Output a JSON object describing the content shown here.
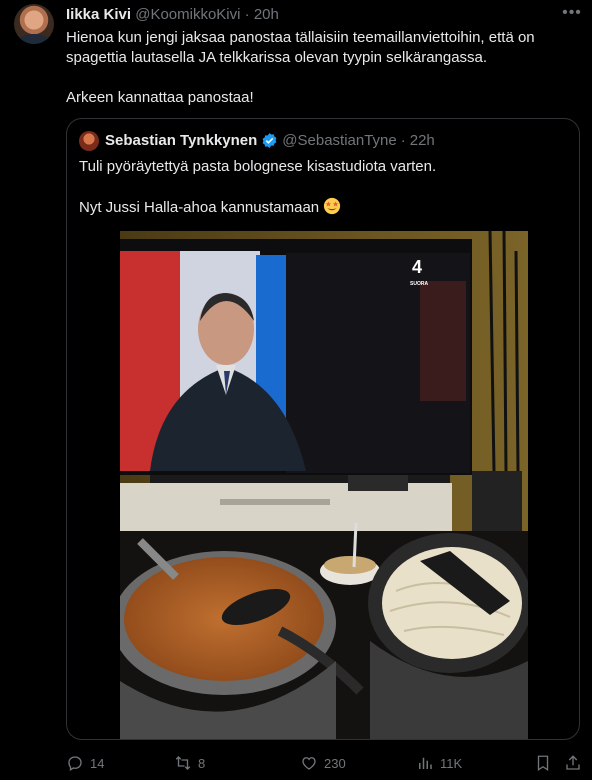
{
  "tweet": {
    "author_name": "Iikka Kivi",
    "author_handle": "@KoomikkoKivi",
    "separator": "·",
    "time": "20h",
    "text_lines": [
      "Hienoa kun jengi jaksaa panostaa tällaisiin teemaillanviettoihin, että on spagettia lautasella JA telkkarissa olevan tyypin selkärangassa.",
      "",
      "Arkeen kannattaa panostaa!"
    ]
  },
  "quote": {
    "author_name": "Sebastian Tynkkynen",
    "author_handle": "@SebastianTyne",
    "separator": "·",
    "time": "22h",
    "text_lines": [
      "Tuli pyöräytettyä pasta bolognese kisastudiota varten.",
      "",
      "Nyt Jussi Halla-ahoa kannustamaan"
    ],
    "tv_channel_number": "4",
    "tv_channel_label": "SUORA"
  },
  "actions": {
    "replies": "14",
    "retweets": "8",
    "likes": "230",
    "views": "11K"
  },
  "colors": {
    "background": "#000000",
    "text": "#e7e9ea",
    "muted": "#71767b",
    "border": "#2f3336",
    "verified": "#1d9bf0"
  },
  "icons": [
    "more-icon",
    "verified-icon",
    "star-struck-emoji",
    "reply-icon",
    "retweet-icon",
    "like-icon",
    "views-icon",
    "bookmark-icon",
    "share-icon"
  ]
}
